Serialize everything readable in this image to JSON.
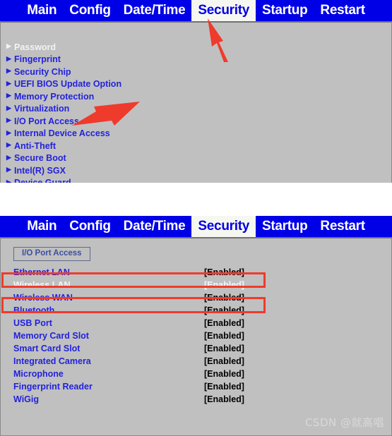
{
  "menubar": {
    "tabs": [
      {
        "label": "Main",
        "active": false
      },
      {
        "label": "Config",
        "active": false
      },
      {
        "label": "Date/Time",
        "active": false
      },
      {
        "label": "Security",
        "active": true
      },
      {
        "label": "Startup",
        "active": false
      },
      {
        "label": "Restart",
        "active": false
      }
    ]
  },
  "security_menu": {
    "items": [
      {
        "label": "Password",
        "selected": true
      },
      {
        "label": "Fingerprint",
        "selected": false
      },
      {
        "label": "Security Chip",
        "selected": false
      },
      {
        "label": "UEFI BIOS Update Option",
        "selected": false
      },
      {
        "label": "Memory Protection",
        "selected": false
      },
      {
        "label": "Virtualization",
        "selected": false
      },
      {
        "label": "I/O Port Access",
        "selected": false
      },
      {
        "label": "Internal Device Access",
        "selected": false
      },
      {
        "label": "Anti-Theft",
        "selected": false
      },
      {
        "label": "Secure Boot",
        "selected": false
      },
      {
        "label": "Intel(R) SGX",
        "selected": false
      },
      {
        "label": "Device Guard",
        "selected": false
      }
    ]
  },
  "io_port_access": {
    "section_title": "I/O Port Access",
    "rows": [
      {
        "label": "Ethernet LAN",
        "value": "[Enabled]",
        "selected": false,
        "highlighted": false
      },
      {
        "label": "Wireless LAN",
        "value": "[Enabled]",
        "selected": true,
        "highlighted": true
      },
      {
        "label": "Wireless WAN",
        "value": "[Enabled]",
        "selected": false,
        "highlighted": false
      },
      {
        "label": "Bluetooth",
        "value": "[Enabled]",
        "selected": false,
        "highlighted": true
      },
      {
        "label": "USB Port",
        "value": "[Enabled]",
        "selected": false,
        "highlighted": false
      },
      {
        "label": "Memory Card Slot",
        "value": "[Enabled]",
        "selected": false,
        "highlighted": false
      },
      {
        "label": "Smart Card Slot",
        "value": "[Enabled]",
        "selected": false,
        "highlighted": false
      },
      {
        "label": "Integrated Camera",
        "value": "[Enabled]",
        "selected": false,
        "highlighted": false
      },
      {
        "label": "Microphone",
        "value": "[Enabled]",
        "selected": false,
        "highlighted": false
      },
      {
        "label": "Fingerprint Reader",
        "value": "[Enabled]",
        "selected": false,
        "highlighted": false
      },
      {
        "label": "WiGig",
        "value": "[Enabled]",
        "selected": false,
        "highlighted": false
      }
    ]
  },
  "annotations": {
    "arrow_to_security_tab": "red-arrow-icon",
    "arrow_to_io_port_access": "red-arrow-icon",
    "highlight_color": "#EF3B2C"
  },
  "watermark": {
    "text": "CSDN @就高唱"
  },
  "colors": {
    "menubar_bg": "#0000E6",
    "menubar_text": "#FFFFFF",
    "active_tab_bg": "#F7F7F2",
    "active_tab_text": "#0000E6",
    "panel_bg": "#C0C0C0",
    "item_text": "#2222DD",
    "selected_text": "#F2F2F2",
    "value_text": "#000000"
  }
}
